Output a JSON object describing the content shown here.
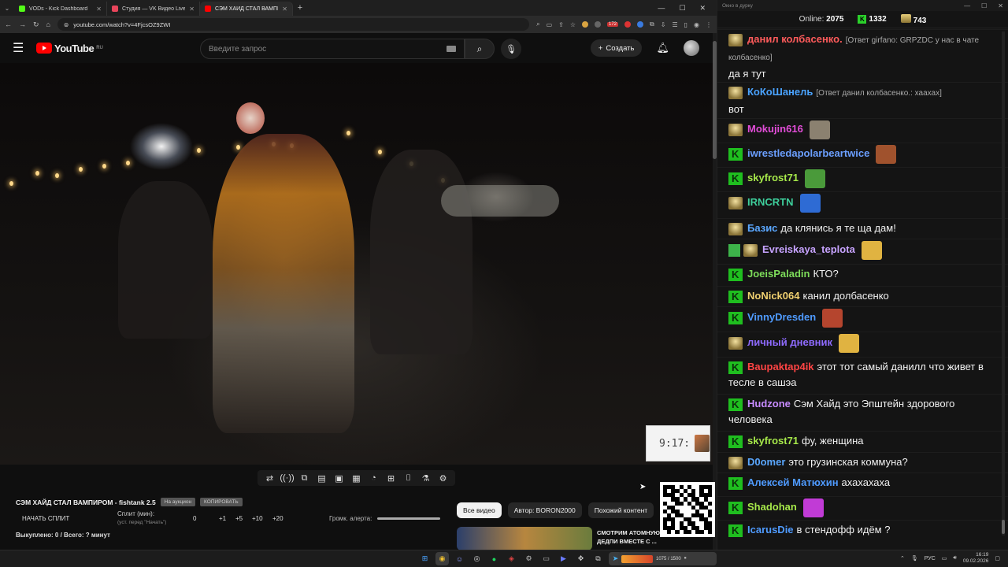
{
  "browser": {
    "tabs": [
      {
        "label": "VODs - Kick Dashboard",
        "color": "#53fc18"
      },
      {
        "label": "Студия — VK Видео Live",
        "color": "#e8455b"
      },
      {
        "label": "СЭМ ХАЙД СТАЛ ВАМПИ…",
        "color": "#ff0000"
      }
    ],
    "url": "youtube.com/watch?v=4FjcsOZ9ZWI",
    "ext_badge": "172"
  },
  "youtube": {
    "logo_text": "YouTube",
    "country": "RU",
    "search_placeholder": "Введите запрос",
    "create_label": "Создать"
  },
  "video": {
    "overlay_clock": "9:17:"
  },
  "below": {
    "title": "СЭМ ХАЙД СТАЛ ВАМПИРОМ - fishtank 2.5",
    "tag1": "На аукцион",
    "tag2": "КОПИРОВАТЬ",
    "split_button": "НАЧАТЬ СПЛИТ",
    "split_label": "Сплит (мин):",
    "split_sub": "(уст. перед \"Начать\")",
    "split_values": [
      "0",
      "+1",
      "+5",
      "+10",
      "+20"
    ],
    "volume_label": "Громк. алерта:",
    "bought": "Выкуплено: 0 / Всего: ? минут",
    "chips": [
      "Все видео",
      "Автор: BORON2000",
      "Похожий контент"
    ],
    "rec_title": "СМОТРИМ АТОМНУЮ БОМБУ ДЕДПИ ВМЕСТЕ С ..."
  },
  "chat": {
    "window_title": "Окно в дурку",
    "online_label": "Online:",
    "online_count": "2075",
    "kick_count": "1332",
    "gold_count": "743",
    "messages": [
      {
        "badge": "g",
        "user": "данил колбасенко.",
        "color": "#ff5b5b",
        "reply": "[Ответ girfano: GRPZDC у нас в чате колбасенко]",
        "text": "да я тут"
      },
      {
        "badge": "g",
        "user": "КоКоШанель",
        "color": "#4aa3ff",
        "reply": "[Ответ данил колбасенко.: хаахах]",
        "text": "вот"
      },
      {
        "badge": "g",
        "user": "Mokujin616",
        "color": "#e24dd8",
        "text": "",
        "emote": "#8b8170"
      },
      {
        "badge": "k",
        "user": "iwrestledapolarbeartwice",
        "color": "#6b9fff",
        "text": "",
        "emote": "#a0522d"
      },
      {
        "badge": "k",
        "user": "skyfrost71",
        "color": "#a6e84a",
        "text": "",
        "emote": "#4a9a3a"
      },
      {
        "badge": "g",
        "user": "IRNCRTN",
        "color": "#3ecf9c",
        "text": "",
        "emote": "#2e6bd4"
      },
      {
        "badge": "g",
        "user": "Базис",
        "color": "#5aa7ff",
        "text": "да клянись я те ща дам!"
      },
      {
        "badge": "v",
        "user": "Evreiskaya_teplota",
        "color": "#c7a3ff",
        "text": "",
        "emote": "#e0b341"
      },
      {
        "badge": "k",
        "user": "JoeisPaladin",
        "color": "#7ddc5a",
        "text": "КТО?"
      },
      {
        "badge": "k",
        "user": "NoNick064",
        "color": "#f0d070",
        "text": "канил долбасенко"
      },
      {
        "badge": "k",
        "user": "VinnyDresden",
        "color": "#4f9bff",
        "text": "",
        "emote": "#b5452e"
      },
      {
        "badge": "g",
        "user": "личный дневник",
        "color": "#8f6bff",
        "text": "",
        "emote": "#e0b341"
      },
      {
        "badge": "k",
        "user": "Baupaktap4ik",
        "color": "#ff4444",
        "text": "этот тот самый данилл что живет в тесле в сашэа"
      },
      {
        "badge": "k",
        "user": "Hudzone",
        "color": "#c78bff",
        "text": "Сэм Хайд это Эпштейн здорового человека"
      },
      {
        "badge": "k",
        "user": "skyfrost71",
        "color": "#a6e84a",
        "text": "фу, женщина"
      },
      {
        "badge": "g",
        "user": "D0omer",
        "color": "#5aa7ff",
        "text": "это грузинская коммуна?"
      },
      {
        "badge": "k",
        "user": "Алексей Матюхин",
        "color": "#4f9bff",
        "text": "ахахахаха"
      },
      {
        "badge": "k",
        "user": "Shadohan",
        "color": "#a6e84a",
        "text": "",
        "emote": "#c13bd6"
      },
      {
        "badge": "k",
        "user": "IcarusDie",
        "color": "#4f9bff",
        "text": "в стендофф идём ?"
      }
    ]
  },
  "taskbar": {
    "media_text": "1075 / 1500",
    "lang": "РУС",
    "time": "16:19",
    "date": "09.02.2026"
  }
}
